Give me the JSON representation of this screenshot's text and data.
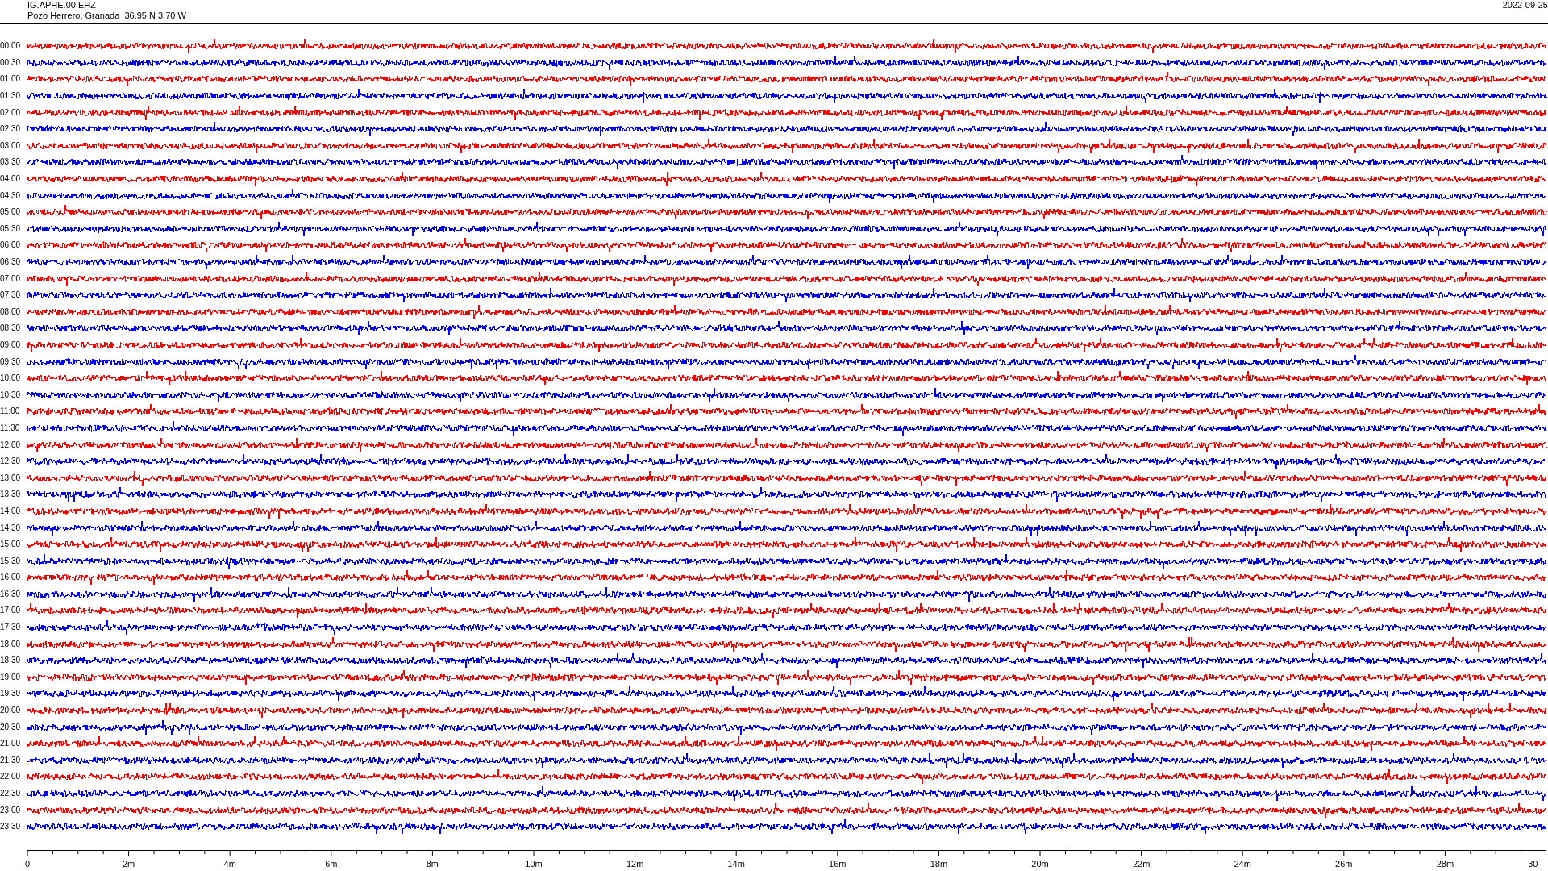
{
  "header": {
    "station": "IG.APHE.00.EHZ",
    "location": "Pozo Herrero, Granada  36.95 N 3.70 W",
    "date": "2022-09-25"
  },
  "rows": [
    {
      "time": "00:00",
      "color": "#ff0000"
    },
    {
      "time": "00:30",
      "color": "#0000ff"
    },
    {
      "time": "01:00",
      "color": "#ff0000"
    },
    {
      "time": "01:30",
      "color": "#0000ff"
    },
    {
      "time": "02:00",
      "color": "#ff0000"
    },
    {
      "time": "02:30",
      "color": "#0000ff"
    },
    {
      "time": "03:00",
      "color": "#ff0000"
    },
    {
      "time": "03:30",
      "color": "#0000ff"
    },
    {
      "time": "04:00",
      "color": "#ff0000"
    },
    {
      "time": "04:30",
      "color": "#0000ff"
    },
    {
      "time": "05:00",
      "color": "#ff0000"
    },
    {
      "time": "05:30",
      "color": "#0000ff"
    },
    {
      "time": "06:00",
      "color": "#ff0000"
    },
    {
      "time": "06:30",
      "color": "#0000ff"
    },
    {
      "time": "07:00",
      "color": "#ff0000"
    },
    {
      "time": "07:30",
      "color": "#0000ff"
    },
    {
      "time": "08:00",
      "color": "#ff0000"
    },
    {
      "time": "08:30",
      "color": "#0000ff"
    },
    {
      "time": "09:00",
      "color": "#ff0000"
    },
    {
      "time": "09:30",
      "color": "#0000ff"
    },
    {
      "time": "10:00",
      "color": "#ff0000"
    },
    {
      "time": "10:30",
      "color": "#0000ff"
    },
    {
      "time": "11:00",
      "color": "#ff0000"
    },
    {
      "time": "11:30",
      "color": "#0000ff"
    },
    {
      "time": "12:00",
      "color": "#ff0000"
    },
    {
      "time": "12:30",
      "color": "#0000ff"
    },
    {
      "time": "13:00",
      "color": "#ff0000"
    },
    {
      "time": "13:30",
      "color": "#0000ff"
    },
    {
      "time": "14:00",
      "color": "#ff0000"
    },
    {
      "time": "14:30",
      "color": "#0000ff"
    },
    {
      "time": "15:00",
      "color": "#ff0000"
    },
    {
      "time": "15:30",
      "color": "#0000ff"
    },
    {
      "time": "16:00",
      "color": "#ff0000"
    },
    {
      "time": "16:30",
      "color": "#0000ff"
    },
    {
      "time": "17:00",
      "color": "#ff0000"
    },
    {
      "time": "17:30",
      "color": "#0000ff"
    },
    {
      "time": "18:00",
      "color": "#ff0000"
    },
    {
      "time": "18:30",
      "color": "#0000ff"
    },
    {
      "time": "19:00",
      "color": "#ff0000"
    },
    {
      "time": "19:30",
      "color": "#0000ff"
    },
    {
      "time": "20:00",
      "color": "#ff0000"
    },
    {
      "time": "20:30",
      "color": "#0000ff"
    },
    {
      "time": "21:00",
      "color": "#ff0000"
    },
    {
      "time": "21:30",
      "color": "#0000ff"
    },
    {
      "time": "22:00",
      "color": "#ff0000"
    },
    {
      "time": "22:30",
      "color": "#0000ff"
    },
    {
      "time": "23:00",
      "color": "#ff0000"
    },
    {
      "time": "23:30",
      "color": "#0000ff"
    }
  ],
  "x_axis": {
    "ticks": [
      "0",
      "2m",
      "4m",
      "6m",
      "8m",
      "10m",
      "12m",
      "14m",
      "16m",
      "18m",
      "20m",
      "22m",
      "24m",
      "26m",
      "28m",
      "30"
    ]
  }
}
